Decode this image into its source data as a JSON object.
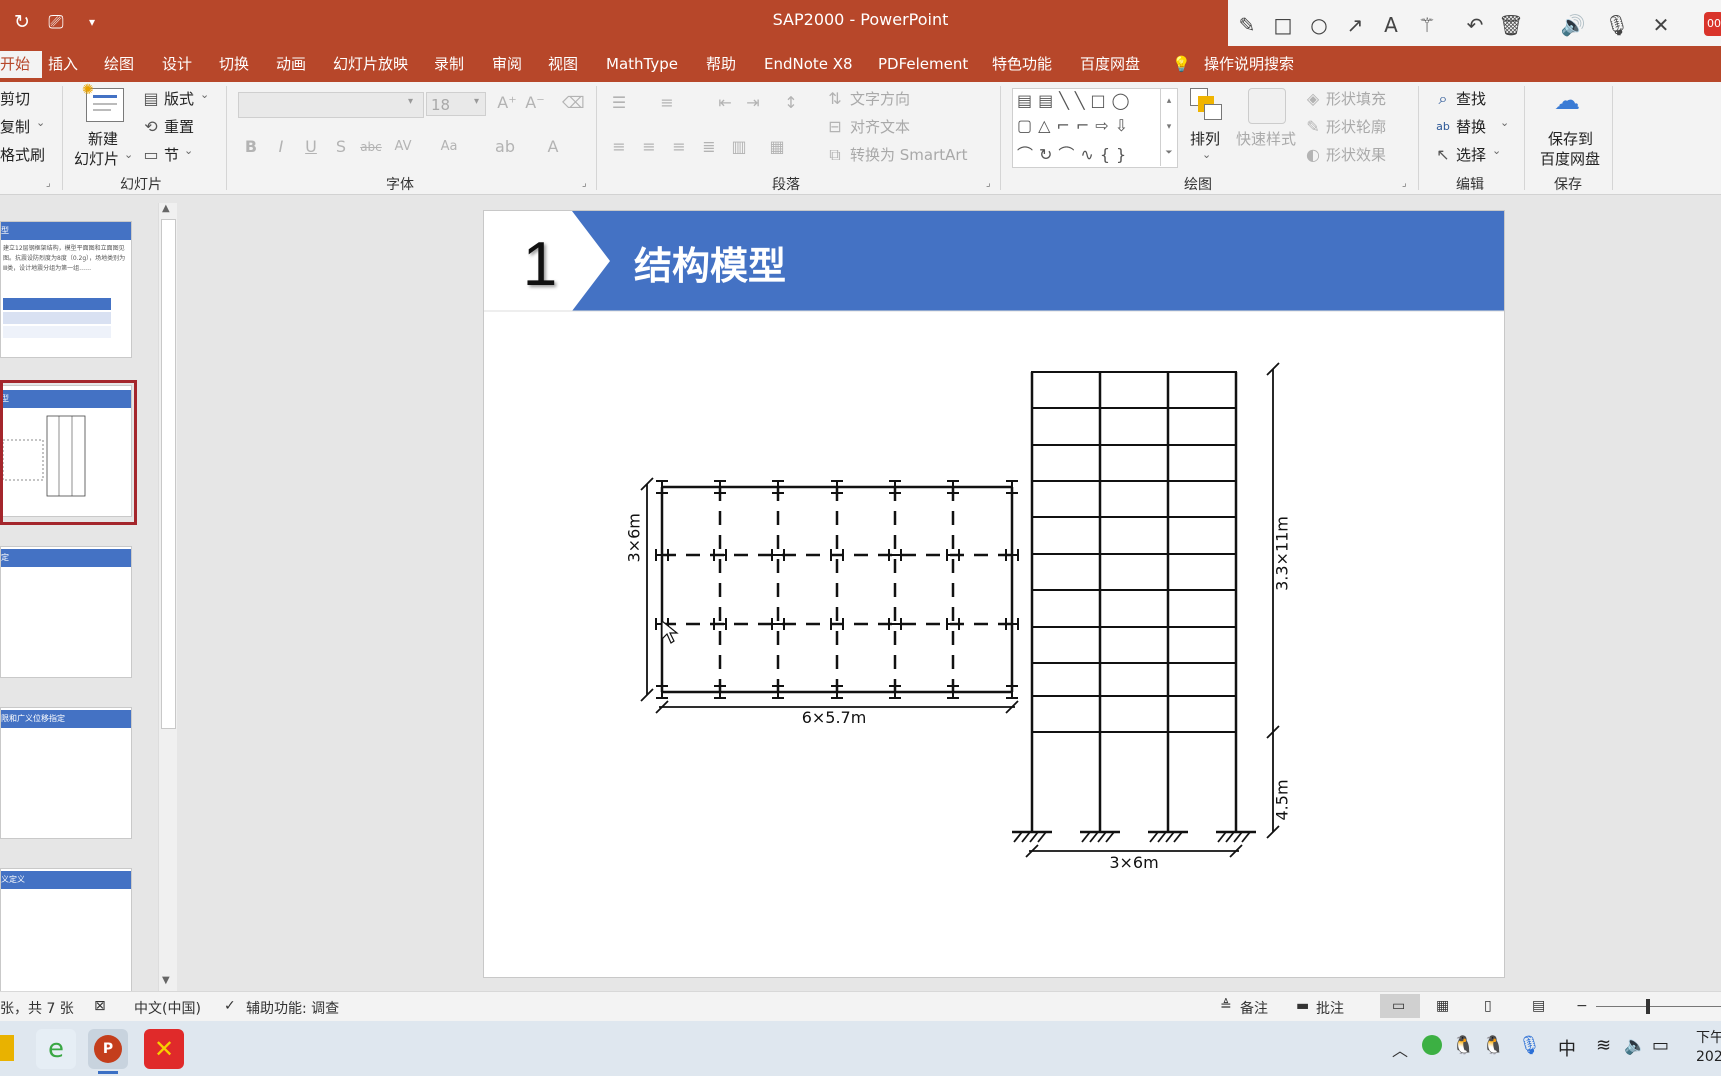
{
  "window": {
    "title": "SAP2000  -  PowerPoint"
  },
  "colors": {
    "accent": "#b7472a",
    "slide_header": "#4472c4",
    "thumb_selected": "#a4262c"
  },
  "quick_access": {
    "icons": [
      "autosave-icon",
      "present-from-start-icon",
      "customize-quick-access-icon"
    ]
  },
  "pen_toolbar": {
    "icons": [
      "pen-icon",
      "rectangle-icon",
      "circle-icon",
      "arrow-icon",
      "text-icon",
      "magic-wand-icon",
      "undo-icon",
      "delete-icon",
      "speaker-icon",
      "microphone-icon",
      "close-icon"
    ],
    "badge": "00"
  },
  "tabs": [
    {
      "label": "开始",
      "active": true
    },
    {
      "label": "插入"
    },
    {
      "label": "绘图"
    },
    {
      "label": "设计"
    },
    {
      "label": "切换"
    },
    {
      "label": "动画"
    },
    {
      "label": "幻灯片放映"
    },
    {
      "label": "录制"
    },
    {
      "label": "审阅"
    },
    {
      "label": "视图"
    },
    {
      "label": "MathType"
    },
    {
      "label": "帮助"
    },
    {
      "label": "EndNote X8"
    },
    {
      "label": "PDFelement"
    },
    {
      "label": "特色功能"
    },
    {
      "label": "百度网盘"
    }
  ],
  "tell_me": "操作说明搜索",
  "ribbon": {
    "clipboard": {
      "cut": "剪切",
      "copy": "复制",
      "format_painter": "格式刷"
    },
    "slides": {
      "new_slide_line1": "新建",
      "new_slide_line2": "幻灯片",
      "layout": "版式",
      "reset": "重置",
      "section": "节",
      "group_label": "幻灯片"
    },
    "font": {
      "font_size": "18",
      "group_label": "字体"
    },
    "paragraph": {
      "text_direction": "文字方向",
      "align_text": "对齐文本",
      "smartart": "转换为 SmartArt",
      "group_label": "段落"
    },
    "drawing": {
      "arrange": "排列",
      "quick_styles": "快速样式",
      "shape_fill": "形状填充",
      "shape_outline": "形状轮廓",
      "shape_effects": "形状效果",
      "group_label": "绘图"
    },
    "editing": {
      "find": "查找",
      "replace": "替换",
      "select": "选择",
      "group_label": "编辑"
    },
    "save": {
      "line1": "保存到",
      "line2": "百度网盘",
      "group_label": "保存"
    }
  },
  "thumbnails": [
    {
      "header": "型",
      "body": "建立12层钢框架结构，模型平面图和立面图见图。抗震设防烈度为8度（0.2g），场地类别为Ⅲ类，设计地震分组为第一组……"
    },
    {
      "header": "型",
      "selected": true
    },
    {
      "header": "定"
    },
    {
      "header": "限和广义位移指定"
    },
    {
      "header": "义定义"
    }
  ],
  "slide": {
    "number": "1",
    "title": "结构模型",
    "plan_dims": {
      "depth": "3×6m",
      "width": "6×5.7m"
    },
    "elevation_dims": {
      "upper": "3.3×11m",
      "lower": "4.5m",
      "width": "3×6m"
    }
  },
  "status": {
    "slide_count": "张，共 7 张",
    "language": "中文(中国)",
    "accessibility": "辅助功能: 调查",
    "notes": "备注",
    "comments": "批注"
  },
  "taskbar": {
    "ime": "中",
    "clock_line1": "下午",
    "clock_line2": "202"
  }
}
